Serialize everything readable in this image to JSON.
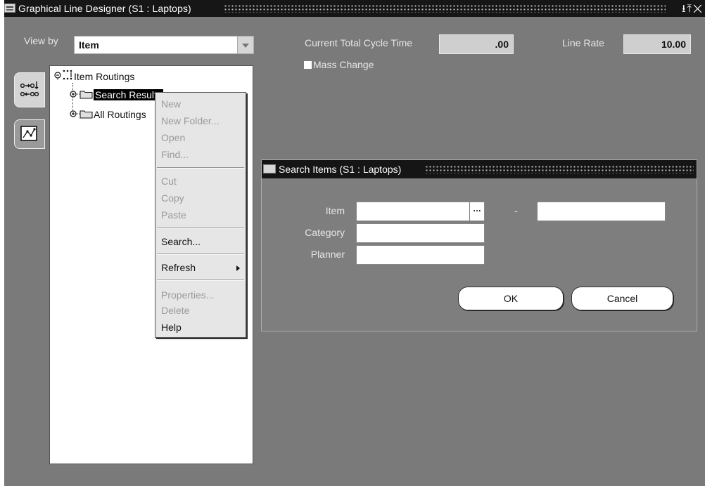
{
  "window": {
    "title": "Graphical Line Designer (S1 : Laptops)",
    "controls": "⭳⤒✕"
  },
  "header": {
    "view_by_label": "View by",
    "view_by_value": "Item",
    "cycle_time_label": "Current Total Cycle Time",
    "cycle_time_value": ".00",
    "line_rate_label": "Line Rate",
    "line_rate_value": "10.00",
    "mass_change_label": "Mass Change"
  },
  "tree": {
    "root": "Item Routings",
    "children": [
      "Search Results",
      "All Routings"
    ]
  },
  "context_menu": {
    "items": [
      {
        "label": "New",
        "enabled": false
      },
      {
        "label": "New Folder...",
        "enabled": false
      },
      {
        "label": "Open",
        "enabled": false
      },
      {
        "label": "Find...",
        "enabled": false
      },
      {
        "label": "Cut",
        "enabled": false
      },
      {
        "label": "Copy",
        "enabled": false
      },
      {
        "label": "Paste",
        "enabled": false
      },
      {
        "label": "Search...",
        "enabled": true
      },
      {
        "label": "Refresh",
        "enabled": true
      },
      {
        "label": "Properties...",
        "enabled": false
      },
      {
        "label": "Delete",
        "enabled": false
      },
      {
        "label": "Help",
        "enabled": true
      }
    ]
  },
  "dialog": {
    "title": "Search Items (S1 : Laptops)",
    "item_label": "Item",
    "category_label": "Category",
    "planner_label": "Planner",
    "range_separator": "-",
    "item_from_value": "",
    "item_to_value": "",
    "category_value": "",
    "planner_value": "",
    "ok_label": "OK",
    "cancel_label": "Cancel"
  },
  "colors": {
    "background": "#7a7a7a",
    "titlebar": "#161616",
    "field": "#ffffff",
    "readonly_field": "#cfcfcf"
  }
}
